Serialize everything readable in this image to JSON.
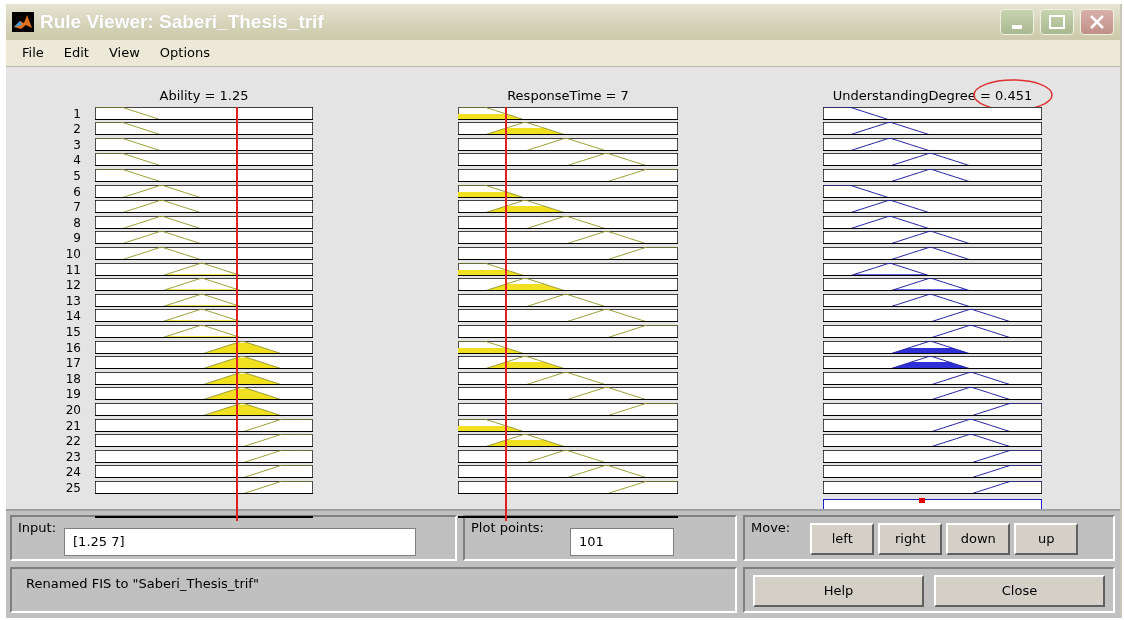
{
  "window": {
    "title": "Rule Viewer: Saberi_Thesis_trif"
  },
  "menu": [
    "File",
    "Edit",
    "View",
    "Options"
  ],
  "variables": [
    {
      "label": "Ability = 1.25",
      "kind": "input",
      "level": 0.65
    },
    {
      "label": "ResponseTime = 7",
      "kind": "input",
      "level": 0.22
    },
    {
      "label": "UnderstandingDegree = 0.451",
      "kind": "output",
      "level": 0.45
    }
  ],
  "rules": [
    {
      "number": "1",
      "mfs": [
        {
          "kind": "very_low"
        },
        {
          "kind": "very_low"
        },
        {
          "kind": "very_low"
        }
      ]
    },
    {
      "number": "2",
      "mfs": [
        {
          "kind": "very_low"
        },
        {
          "kind": "low"
        },
        {
          "kind": "low"
        }
      ]
    },
    {
      "number": "3",
      "mfs": [
        {
          "kind": "very_low"
        },
        {
          "kind": "medium"
        },
        {
          "kind": "low"
        }
      ]
    },
    {
      "number": "4",
      "mfs": [
        {
          "kind": "very_low"
        },
        {
          "kind": "high"
        },
        {
          "kind": "medium"
        }
      ]
    },
    {
      "number": "5",
      "mfs": [
        {
          "kind": "very_low"
        },
        {
          "kind": "very_high"
        },
        {
          "kind": "medium"
        }
      ]
    },
    {
      "number": "6",
      "mfs": [
        {
          "kind": "low"
        },
        {
          "kind": "very_low"
        },
        {
          "kind": "very_low"
        }
      ]
    },
    {
      "number": "7",
      "mfs": [
        {
          "kind": "low"
        },
        {
          "kind": "low"
        },
        {
          "kind": "low"
        }
      ]
    },
    {
      "number": "8",
      "mfs": [
        {
          "kind": "low"
        },
        {
          "kind": "medium"
        },
        {
          "kind": "low"
        }
      ]
    },
    {
      "number": "9",
      "mfs": [
        {
          "kind": "low"
        },
        {
          "kind": "high"
        },
        {
          "kind": "medium"
        }
      ]
    },
    {
      "number": "10",
      "mfs": [
        {
          "kind": "low"
        },
        {
          "kind": "very_high"
        },
        {
          "kind": "medium"
        }
      ]
    },
    {
      "number": "11",
      "mfs": [
        {
          "kind": "medium"
        },
        {
          "kind": "very_low"
        },
        {
          "kind": "low"
        }
      ]
    },
    {
      "number": "12",
      "mfs": [
        {
          "kind": "medium"
        },
        {
          "kind": "low"
        },
        {
          "kind": "medium"
        }
      ]
    },
    {
      "number": "13",
      "mfs": [
        {
          "kind": "medium"
        },
        {
          "kind": "medium"
        },
        {
          "kind": "medium"
        }
      ]
    },
    {
      "number": "14",
      "mfs": [
        {
          "kind": "medium"
        },
        {
          "kind": "high"
        },
        {
          "kind": "high"
        }
      ]
    },
    {
      "number": "15",
      "mfs": [
        {
          "kind": "medium"
        },
        {
          "kind": "very_high"
        },
        {
          "kind": "high"
        }
      ]
    },
    {
      "number": "16",
      "mfs": [
        {
          "kind": "high"
        },
        {
          "kind": "very_low"
        },
        {
          "kind": "medium"
        }
      ]
    },
    {
      "number": "17",
      "mfs": [
        {
          "kind": "high"
        },
        {
          "kind": "low"
        },
        {
          "kind": "medium"
        }
      ]
    },
    {
      "number": "18",
      "mfs": [
        {
          "kind": "high"
        },
        {
          "kind": "medium"
        },
        {
          "kind": "high"
        }
      ]
    },
    {
      "number": "19",
      "mfs": [
        {
          "kind": "high"
        },
        {
          "kind": "high"
        },
        {
          "kind": "high"
        }
      ]
    },
    {
      "number": "20",
      "mfs": [
        {
          "kind": "high"
        },
        {
          "kind": "very_high"
        },
        {
          "kind": "very_high"
        }
      ]
    },
    {
      "number": "21",
      "mfs": [
        {
          "kind": "very_high"
        },
        {
          "kind": "very_low"
        },
        {
          "kind": "high"
        }
      ]
    },
    {
      "number": "22",
      "mfs": [
        {
          "kind": "very_high"
        },
        {
          "kind": "low"
        },
        {
          "kind": "high"
        }
      ]
    },
    {
      "number": "23",
      "mfs": [
        {
          "kind": "very_high"
        },
        {
          "kind": "medium"
        },
        {
          "kind": "very_high"
        }
      ]
    },
    {
      "number": "24",
      "mfs": [
        {
          "kind": "very_high"
        },
        {
          "kind": "high"
        },
        {
          "kind": "very_high"
        }
      ]
    },
    {
      "number": "25",
      "mfs": [
        {
          "kind": "very_high"
        },
        {
          "kind": "very_high"
        },
        {
          "kind": "very_high"
        }
      ]
    }
  ],
  "input": {
    "label": "Input:",
    "value": "[1.25 7]"
  },
  "plot_points": {
    "label": "Plot points:",
    "value": "101"
  },
  "move": {
    "label": "Move:",
    "buttons": [
      "left",
      "right",
      "down",
      "up"
    ]
  },
  "status": "Renamed FIS to \"Saberi_Thesis_trif\"",
  "buttons": [
    "Help",
    "Close"
  ]
}
